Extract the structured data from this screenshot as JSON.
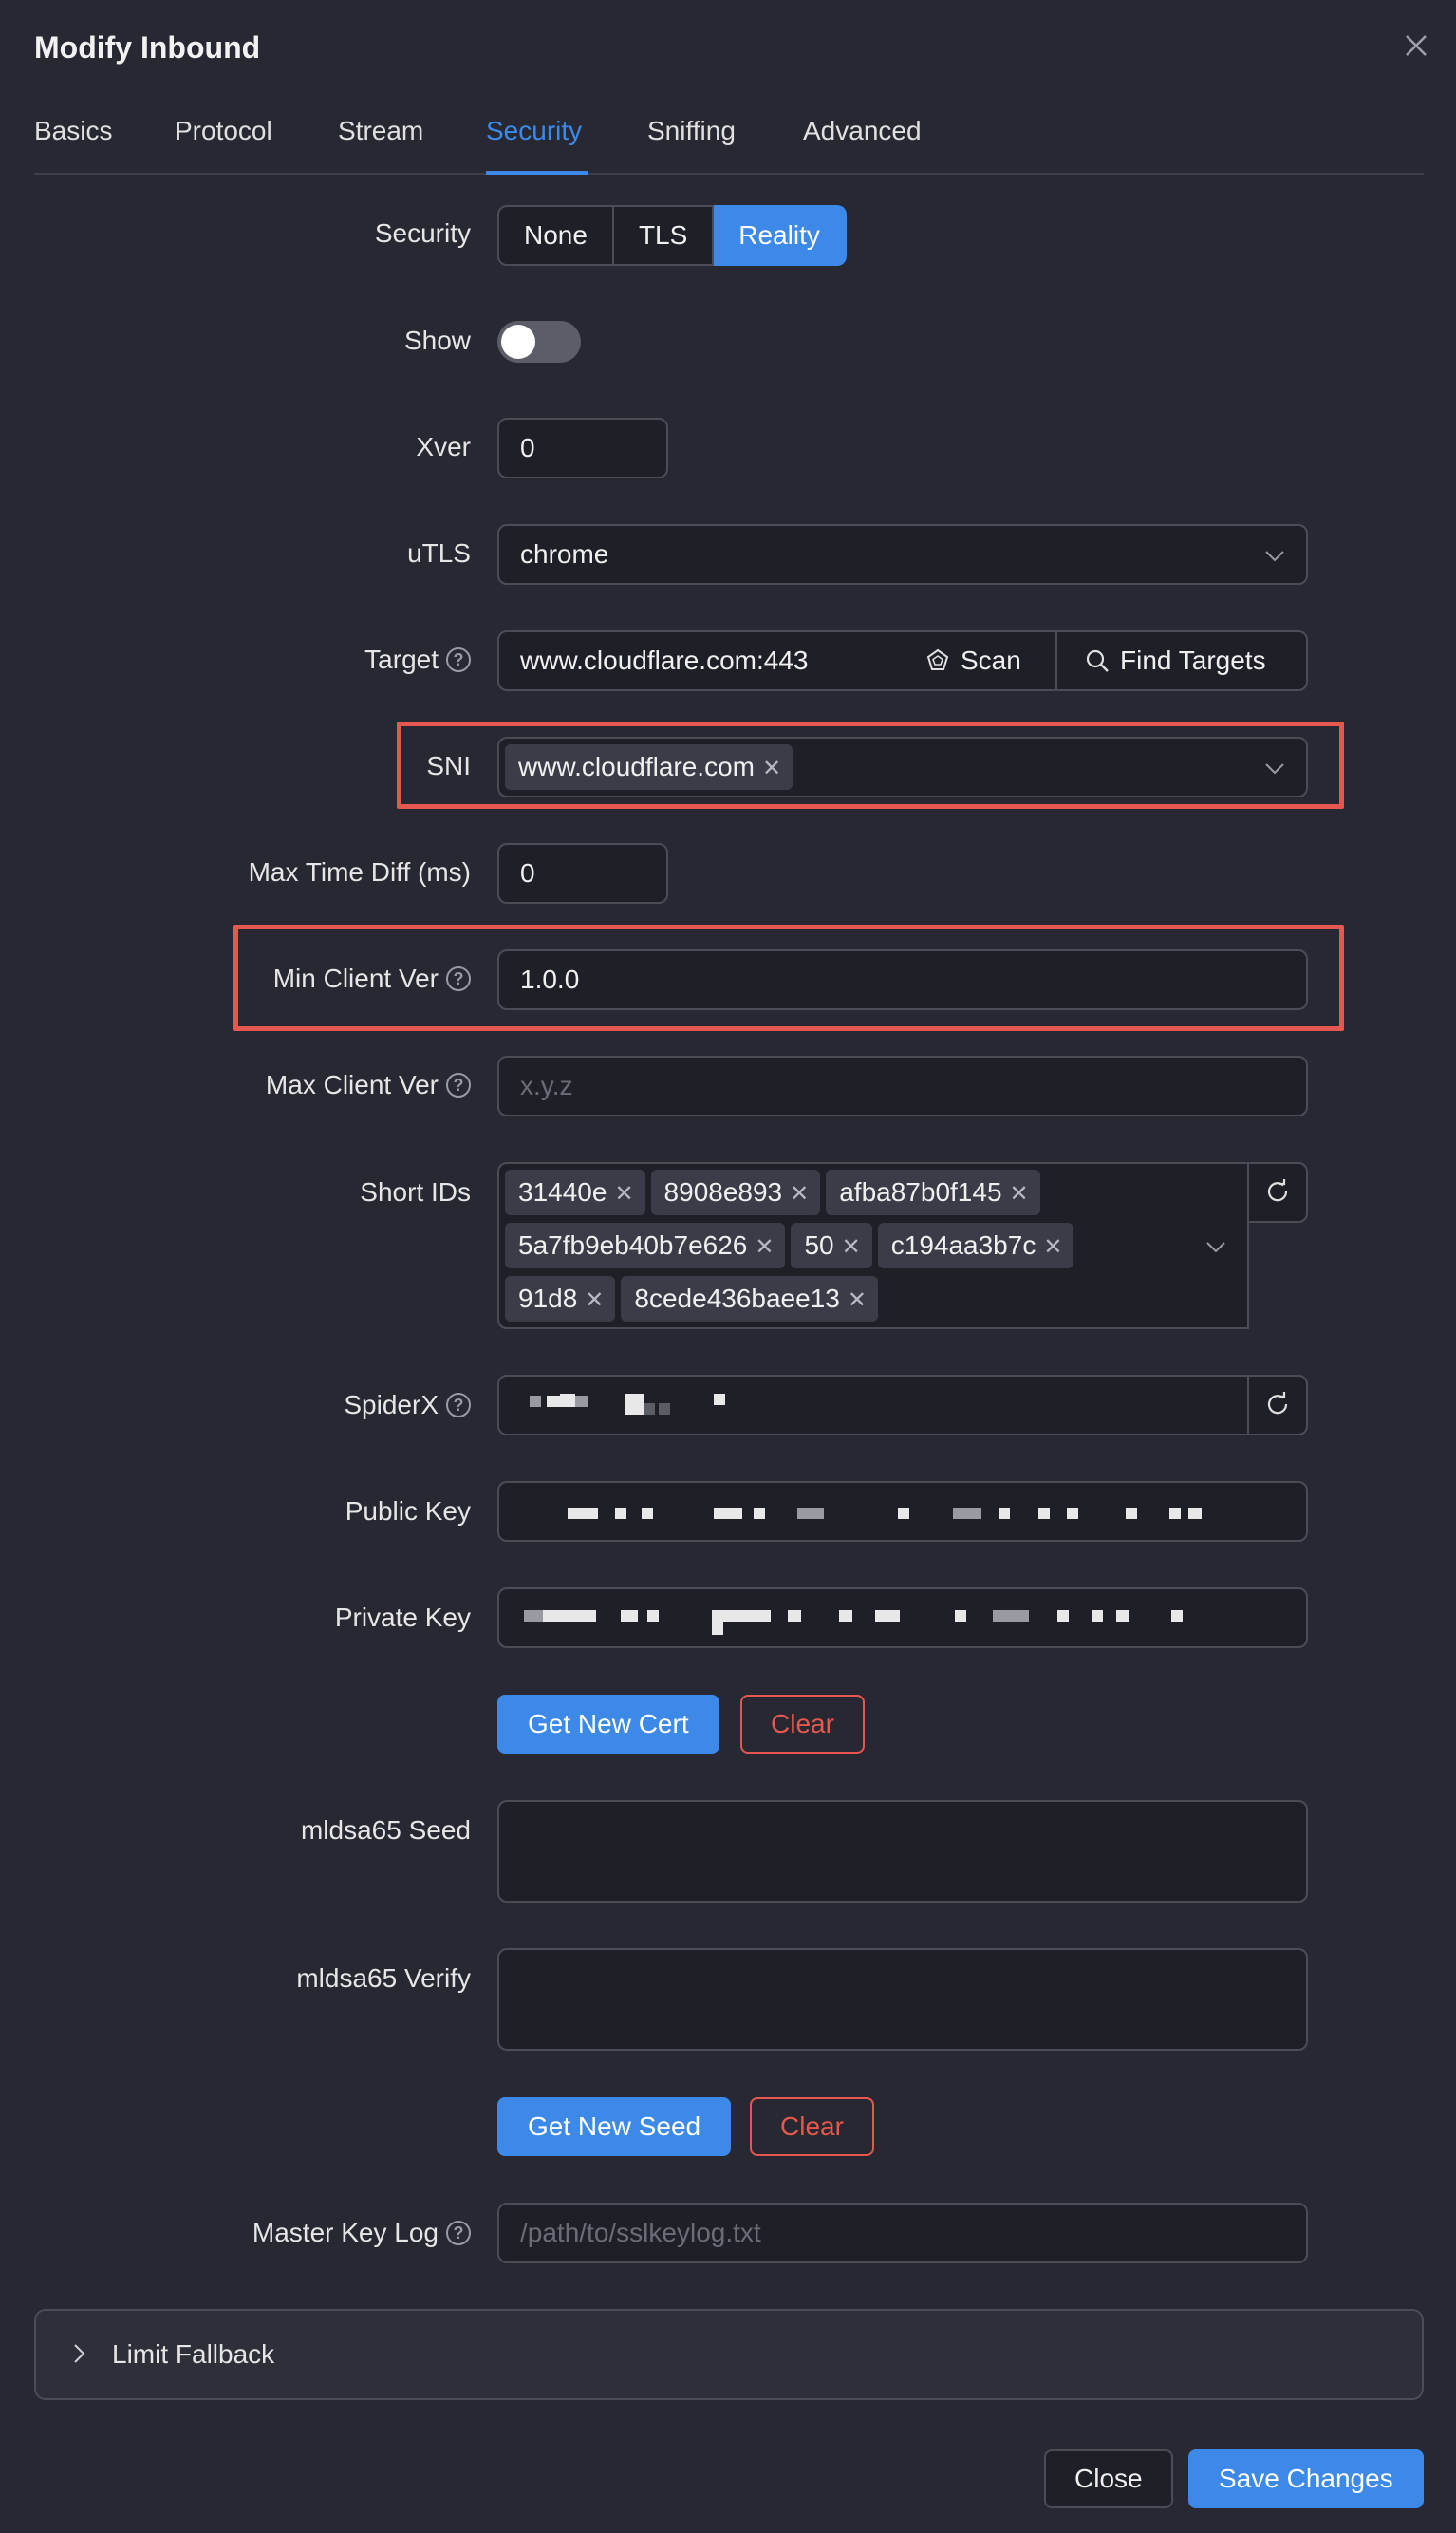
{
  "modal": {
    "title": "Modify Inbound"
  },
  "tabs": [
    {
      "label": "Basics"
    },
    {
      "label": "Protocol"
    },
    {
      "label": "Stream"
    },
    {
      "label": "Security"
    },
    {
      "label": "Sniffing"
    },
    {
      "label": "Advanced"
    }
  ],
  "active_tab": "Security",
  "form": {
    "security": {
      "label": "Security",
      "options": [
        "None",
        "TLS",
        "Reality"
      ],
      "selected": "Reality"
    },
    "show": {
      "label": "Show",
      "on": false
    },
    "xver": {
      "label": "Xver",
      "value": "0"
    },
    "utls": {
      "label": "uTLS",
      "value": "chrome"
    },
    "target": {
      "label": "Target",
      "value": "www.cloudflare.com:443",
      "scan_label": "Scan",
      "find_label": "Find Targets"
    },
    "sni": {
      "label": "SNI",
      "tags": [
        "www.cloudflare.com"
      ]
    },
    "max_time_diff": {
      "label": "Max Time Diff (ms)",
      "value": "0"
    },
    "min_client_ver": {
      "label": "Min Client Ver",
      "value": "1.0.0"
    },
    "max_client_ver": {
      "label": "Max Client Ver",
      "placeholder": "x.y.z"
    },
    "short_ids": {
      "label": "Short IDs",
      "tags": [
        "31440e",
        "8908e893",
        "afba87b0f145",
        "5a7fb9eb40b7e626",
        "50",
        "c194aa3b7c",
        "91d8",
        "8cede436baee13"
      ]
    },
    "spiderx": {
      "label": "SpiderX"
    },
    "public_key": {
      "label": "Public Key"
    },
    "private_key": {
      "label": "Private Key"
    },
    "get_new_cert": "Get New Cert",
    "clear_cert": "Clear",
    "mldsa65_seed": {
      "label": "mldsa65 Seed",
      "value": ""
    },
    "mldsa65_verify": {
      "label": "mldsa65 Verify",
      "value": ""
    },
    "get_new_seed": "Get New Seed",
    "clear_seed": "Clear",
    "master_key_log": {
      "label": "Master Key Log",
      "placeholder": "/path/to/sslkeylog.txt"
    }
  },
  "limit_fallback": {
    "label": "Limit Fallback"
  },
  "footer": {
    "close_label": "Close",
    "save_label": "Save Changes"
  },
  "colors": {
    "accent": "#3c89e8",
    "danger": "#e5574f",
    "highlight": "#e5574f",
    "background": "#272831"
  }
}
